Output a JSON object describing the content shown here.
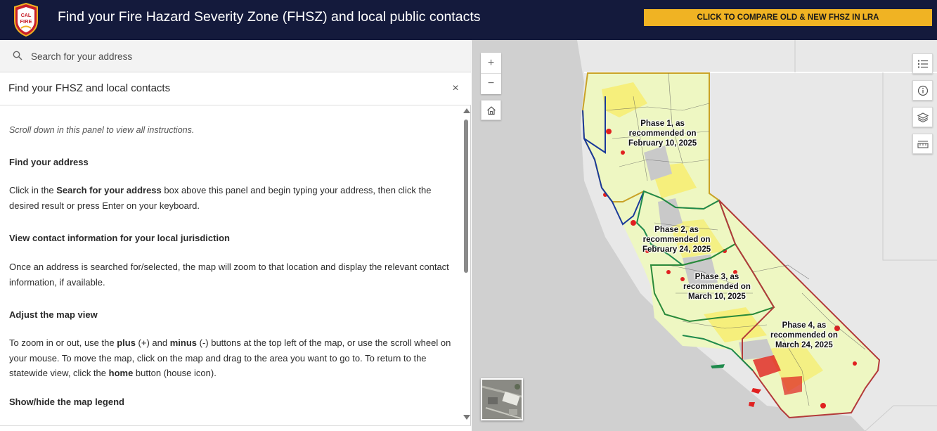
{
  "header": {
    "title": "Find your Fire Hazard Severity Zone (FHSZ) and local public contacts",
    "compare_button": "CLICK TO COMPARE OLD & NEW FHSZ IN LRA",
    "logo_text": "CAL FIRE"
  },
  "search": {
    "placeholder": "Search for your address"
  },
  "panel": {
    "title": "Find your FHSZ and local contacts",
    "close_symbol": "×",
    "intro": "Scroll down in this panel to view all instructions.",
    "sections": [
      {
        "heading": "Find your address",
        "body_parts": [
          "Click in the ",
          "Search for your address",
          " box above this panel and begin typing your address, then click the desired result or press Enter on your keyboard."
        ]
      },
      {
        "heading": "View contact information for your local jurisdiction",
        "body": "Once an address is searched for/selected, the map will zoom to that location and display the relevant contact information, if available."
      },
      {
        "heading": "Adjust the map view",
        "body_parts": [
          "To zoom in or out, use the ",
          "plus",
          " (+) and ",
          "minus",
          " (-) buttons at the top left of the map, or use the scroll wheel on your mouse. To move the map, click on the map and drag to the area you want to go to. To return to the statewide view, click the ",
          "home",
          " button (house icon)."
        ]
      },
      {
        "heading": "Show/hide the map legend"
      }
    ]
  },
  "map": {
    "zoom_in": "+",
    "zoom_out": "−",
    "phases": [
      {
        "line1": "Phase 1, as",
        "line2": "recommended on",
        "line3": "February 10, 2025",
        "color": "#c9a227"
      },
      {
        "line1": "Phase 2, as",
        "line2": "recommended on",
        "line3": "February 24, 2025",
        "color": "#1f8a4c"
      },
      {
        "line1": "Phase 3, as",
        "line2": "recommended on",
        "line3": "March 10, 2025",
        "color": "#2a8a3a"
      },
      {
        "line1": "Phase 4, as",
        "line2": "recommended on",
        "line3": "March 24, 2025",
        "color": "#b33a3a"
      }
    ],
    "widgets": [
      "legend-icon",
      "info-icon",
      "layers-icon",
      "measure-icon"
    ]
  },
  "colors": {
    "header_bg": "#141a3c",
    "accent": "#f0b323",
    "very_high": "#e02020",
    "high": "#f5e542",
    "moderate": "#e6f5b8"
  }
}
